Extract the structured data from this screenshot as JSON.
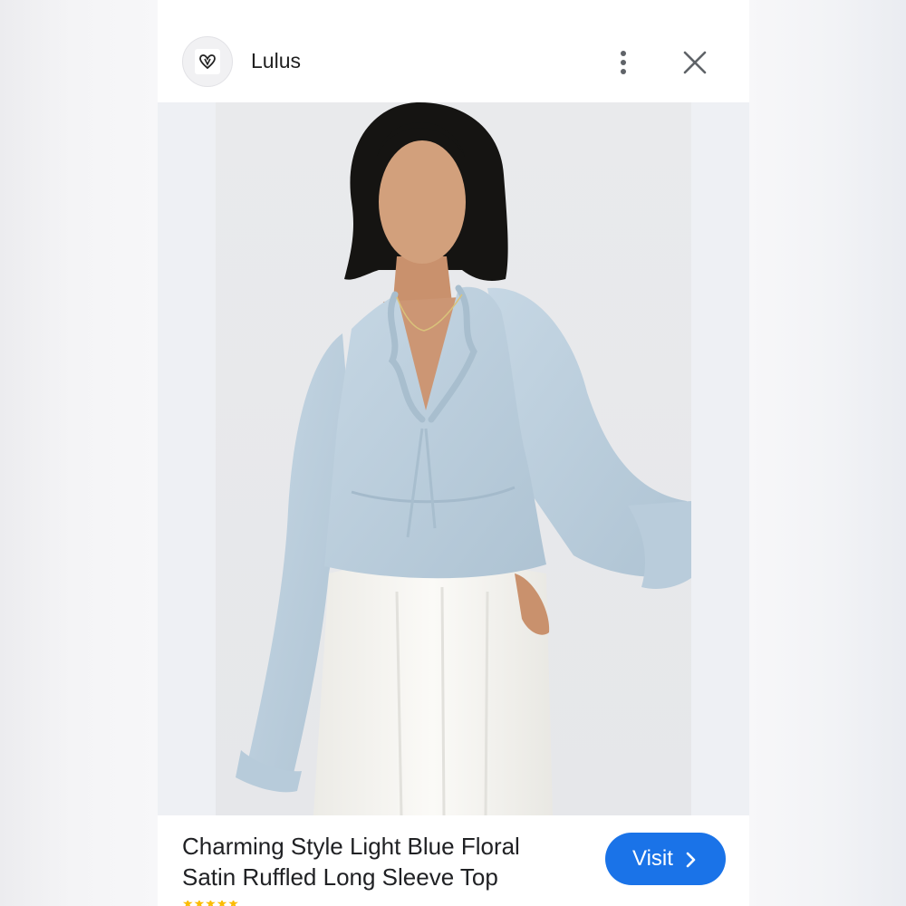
{
  "header": {
    "brand": "Lulus",
    "logo_icon": "heart-icon",
    "menu_icon": "more-vert-icon",
    "close_icon": "close-icon"
  },
  "product": {
    "title_line1": "Charming Style Light Blue Floral",
    "title_line2": "Satin Ruffled Long Sleeve Top",
    "visit_label": "Visit",
    "visit_icon": "chevron-right-icon"
  },
  "colors": {
    "accent": "#1a73e8",
    "blouse": "#bcd0df",
    "skirt": "#f5f4f0",
    "hair": "#151412"
  }
}
